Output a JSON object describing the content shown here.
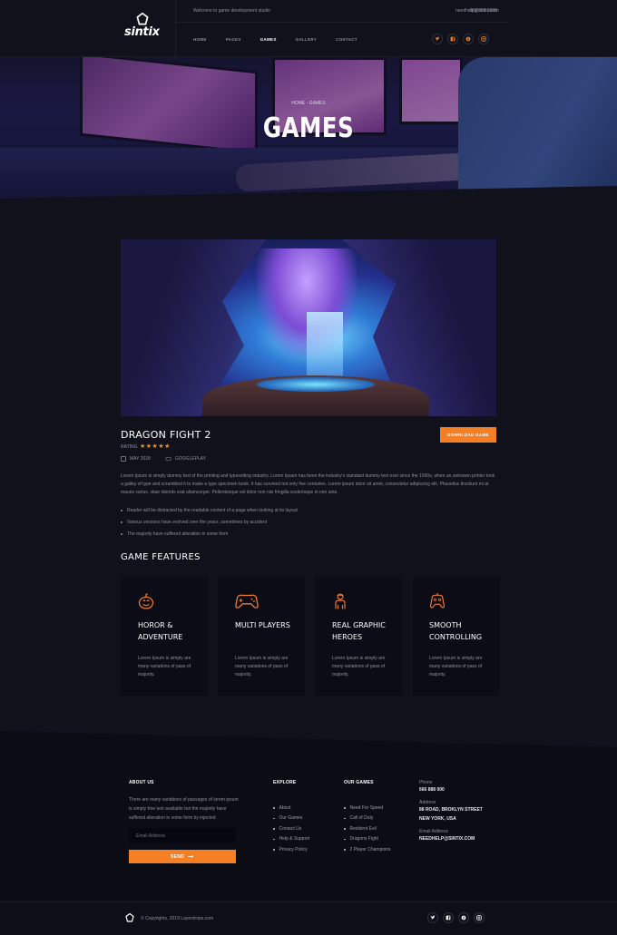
{
  "header": {
    "logo_text": "sintix",
    "welcome": "Welcome to game development studio",
    "phone": "666 888 0000",
    "email": "needhelp@sintix.com",
    "nav": [
      {
        "label": "HOME",
        "active": false
      },
      {
        "label": "PAGES",
        "active": false
      },
      {
        "label": "GAMES",
        "active": true
      },
      {
        "label": "GALLERY",
        "active": false
      },
      {
        "label": "CONTACT",
        "active": false
      }
    ],
    "socials": [
      "twitter-icon",
      "facebook-icon",
      "pinterest-icon",
      "instagram-icon"
    ]
  },
  "hero": {
    "breadcrumb": "HOME - GAMES",
    "title": "GAMES"
  },
  "game": {
    "title": "DRAGON FIGHT 2",
    "rating_label": "RATING",
    "stars": "★★★★★",
    "date": "MAY 2018",
    "platform": "GOOGLEPLAY",
    "download_label": "DOWNLOAD GAME",
    "description": "Lorem Ipsum is simply dummy text of the printing and typesetting industry. Lorem Ipsum has been the industry's standard dummy text ever since the 1500s, when an unknown printer took a galley of type and scrambled it to make a type specimen book. It has survived not only five centuries. Lorem ipsum dolor sit amet, consectetur adipiscing elit. Phasellus tincidunt mi at mauris varius, vitae lobortis erat ullamcorper. Pellentesque vel dolor non nisi fringilla scelerisque in non ante.",
    "bullets": [
      "Reader will be distracted by the readable content of a page when looking at its layout",
      "Various versions have evolved over the years, sometimes by accident",
      "The majority have suffered alteration in some form"
    ]
  },
  "features": {
    "title": "GAME FEATURES",
    "items": [
      {
        "icon": "pumpkin-icon",
        "title": "HOROR & ADVENTURE",
        "text": "Lorem Ipsum is simply are many variations of pass of majority."
      },
      {
        "icon": "gamepad-icon",
        "title": "MULTI PLAYERS",
        "text": "Lorem Ipsum is simply are many variations of pass of majority."
      },
      {
        "icon": "character-icon",
        "title": "REAL GRAPHIC HEROES",
        "text": "Lorem Ipsum is simply are many variations of pass of majority."
      },
      {
        "icon": "controller-icon",
        "title": "SMOOTH CONTROLLING",
        "text": "Lorem Ipsum is simply are many variations of pass of majority."
      }
    ]
  },
  "footer": {
    "about_title": "ABOUT US",
    "about_text": "There are many variations of passages of lorem ipsum is simply free text available but the majority have suffered alteration in some form by injected.",
    "email_placeholder": "Email Address",
    "send_label": "SEND",
    "explore_title": "EXPLORE",
    "explore": [
      "About",
      "Our Games",
      "Contact Us",
      "Help & Support",
      "Privacy Policy"
    ],
    "games_title": "OUR GAMES",
    "games": [
      "Need For Speed",
      "Call of Duty",
      "Resident Evil",
      "Dragons Fight",
      "2 Player Champions"
    ],
    "phone_label": "Phone",
    "phone": "666 888 000",
    "address_label": "Address",
    "address": "88 ROAD, BROKLYN STREET NEW YORK, USA",
    "email_label": "Email Address",
    "email": "NEEDHELP@SINTIX.COM",
    "copyright": "© Copyrights, 2019 Layerdrops.com"
  },
  "colors": {
    "accent": "#f47f24",
    "background": "#10111b",
    "card": "#0b0c15"
  }
}
